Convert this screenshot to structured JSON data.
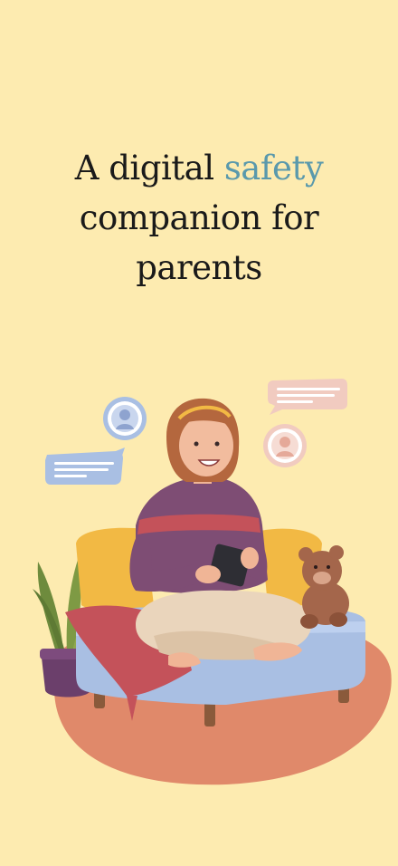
{
  "headline": {
    "before": "A digital ",
    "accent": "safety",
    "line2": "companion for",
    "line3": "parents"
  },
  "colors": {
    "background": "#FDEBB0",
    "accent": "#5A99AC",
    "text": "#1a1a1a"
  },
  "illustration": {
    "icons": [
      "chat-bubble-icon",
      "avatar-icon",
      "teddy-bear-icon",
      "plant-icon",
      "phone-icon"
    ]
  }
}
